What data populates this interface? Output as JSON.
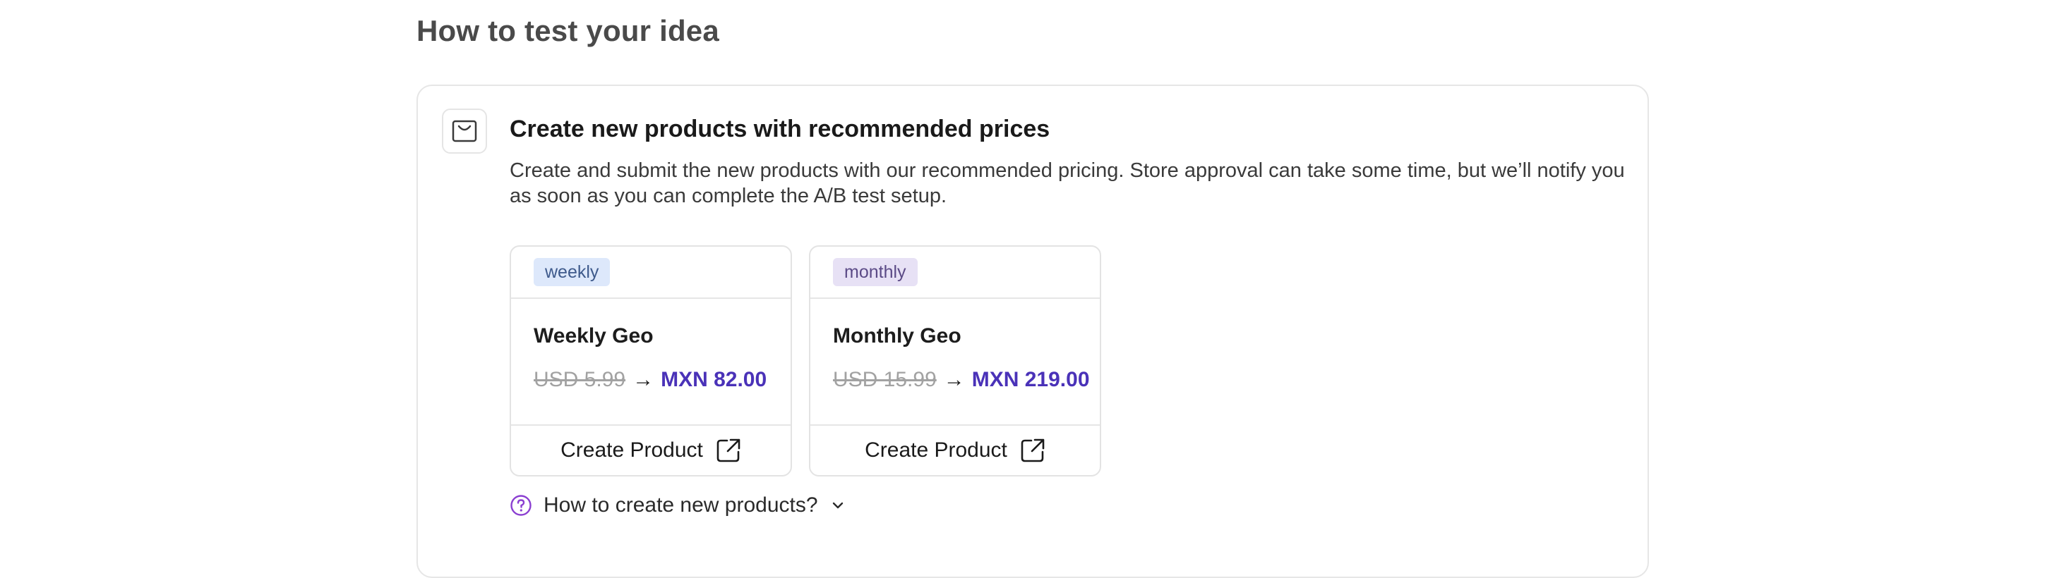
{
  "section": {
    "title": "How to test your idea"
  },
  "step": {
    "icon": "shopping-bag-icon",
    "title": "Create new products with recommended prices",
    "description": "Create and submit the new products with our recommended pricing. Store approval can take some time, but we’ll notify you as soon as you can complete the A/B test setup."
  },
  "products": [
    {
      "badge": "weekly",
      "name": "Weekly Geo",
      "old_price": "USD 5.99",
      "arrow": "→",
      "new_price": "MXN 82.00",
      "action_label": "Create Product",
      "action_icon": "external-link-icon"
    },
    {
      "badge": "monthly",
      "name": "Monthly Geo",
      "old_price": "USD 15.99",
      "arrow": "→",
      "new_price": "MXN 219.00",
      "action_label": "Create Product",
      "action_icon": "external-link-icon"
    }
  ],
  "help": {
    "label": "How to create new products?",
    "icon": "question-circle-icon",
    "toggle_icon": "chevron-down-icon"
  },
  "colors": {
    "accent": "#4a32b8",
    "help_icon": "#8b3fd1",
    "weekly_badge_bg": "#dde8fb",
    "monthly_badge_bg": "#e7e1f5"
  }
}
